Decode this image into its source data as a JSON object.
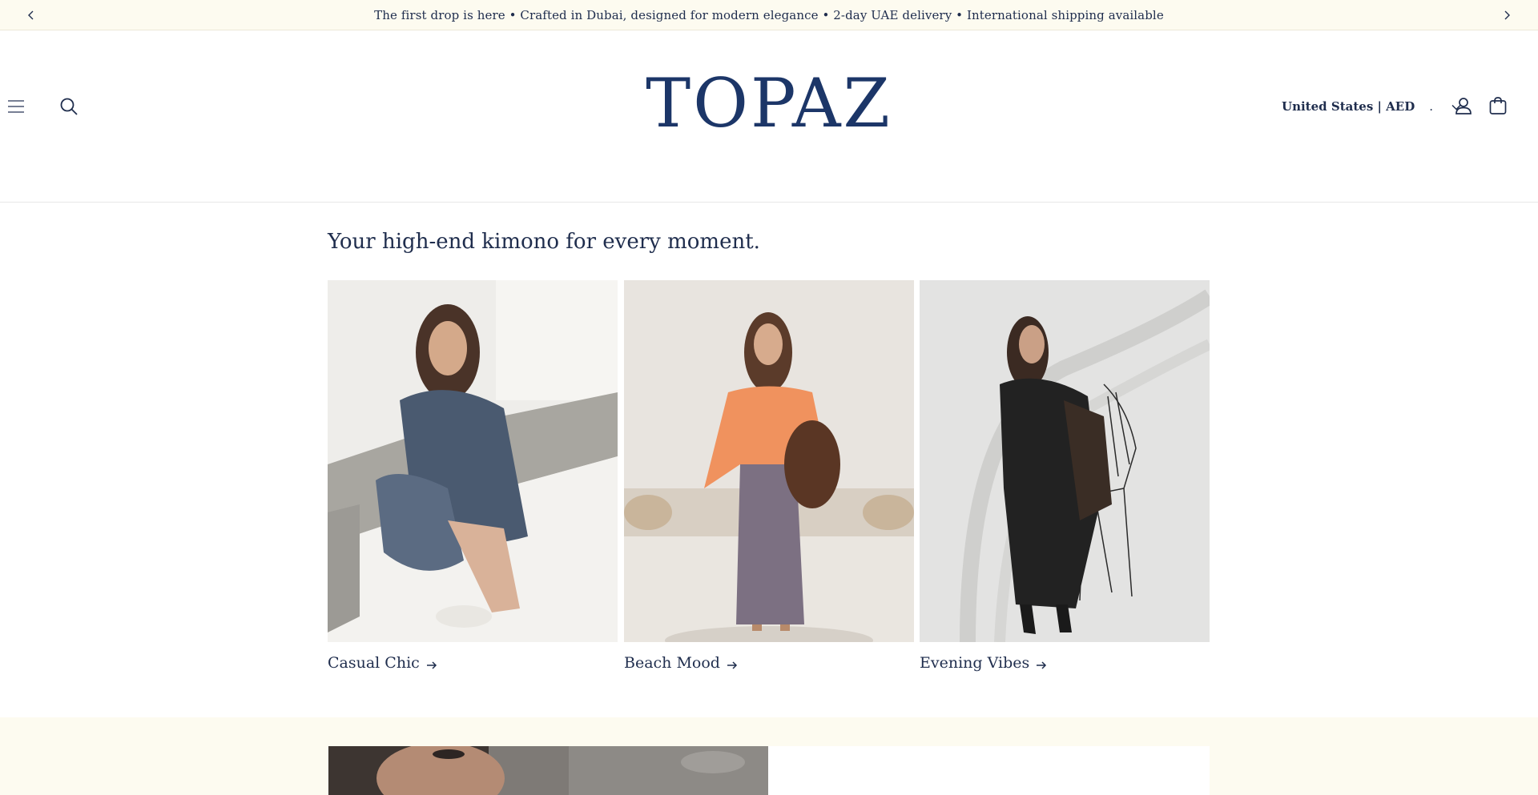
{
  "announcement": {
    "text": "The first drop is here • Crafted in Dubai, designed for modern elegance • 2-day UAE delivery • International shipping available"
  },
  "header": {
    "logo": "TOPAZ",
    "locale_label": "United States | AED",
    "locale_suffix": "."
  },
  "main": {
    "heading": "Your high-end kimono for every moment.",
    "collections": [
      {
        "title": "Casual Chic",
        "arrow": "→"
      },
      {
        "title": "Beach Mood",
        "arrow": "→"
      },
      {
        "title": "Evening Vibes",
        "arrow": "→"
      }
    ]
  },
  "icons": [
    "chevron-left-icon",
    "chevron-right-icon",
    "hamburger-menu-icon",
    "search-icon",
    "chevron-down-icon",
    "account-icon",
    "cart-icon",
    "arrow-right-icon"
  ],
  "colors": {
    "brand_navy": "#1c3668",
    "text": "#1f2d4d",
    "announcement_bg": "#fdfbf0"
  }
}
